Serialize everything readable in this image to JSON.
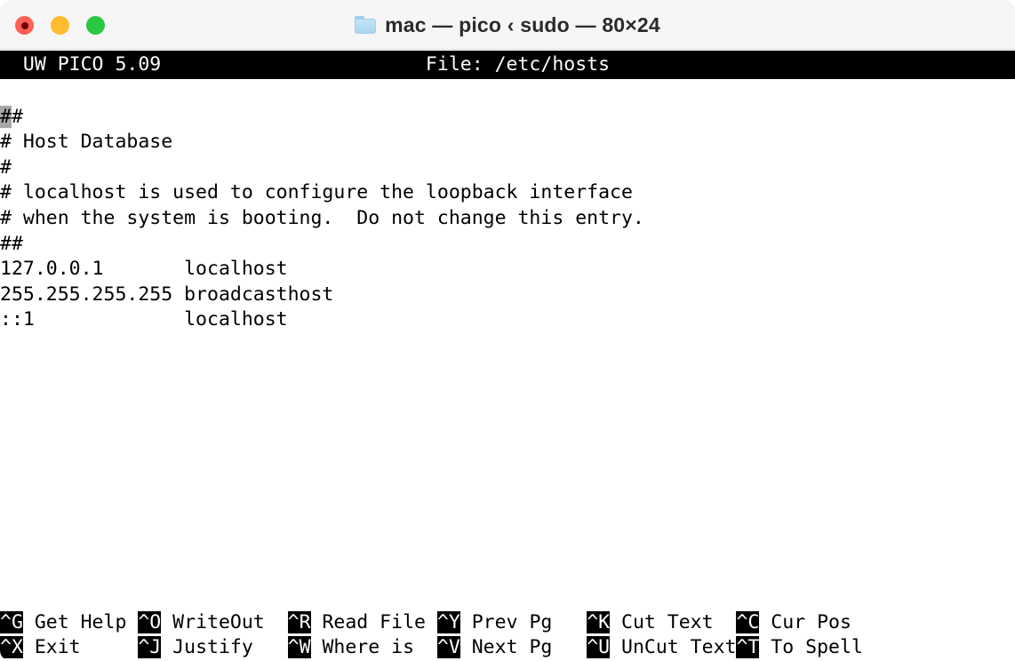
{
  "window": {
    "title": "mac — pico ‹ sudo — 80×24",
    "folder_icon": "folder-icon",
    "traffic_lights": [
      {
        "name": "close",
        "color": "#ff5f57"
      },
      {
        "name": "minimize",
        "color": "#febc2e"
      },
      {
        "name": "zoom",
        "color": "#28c840"
      }
    ]
  },
  "editor": {
    "header": {
      "app_version": "UW PICO 5.09",
      "file_label": "File: /etc/hosts",
      "header_line": "  UW PICO 5.09                       File: /etc/hosts                       ",
      "background": "#000000",
      "foreground": "#ffffff"
    },
    "cursor": {
      "row": 0,
      "col": 0,
      "char": "#",
      "color": "#a8a8a8"
    },
    "content_lines": [
      "##",
      "# Host Database",
      "#",
      "# localhost is used to configure the loopback interface",
      "# when the system is booting.  Do not change this entry.",
      "##",
      "127.0.0.1       localhost",
      "255.255.255.255 broadcasthost",
      "::1             localhost",
      "",
      "",
      "",
      "",
      "",
      "",
      "",
      "",
      "",
      "",
      ""
    ],
    "cursor_line_rest": "#"
  },
  "help_bar": {
    "rows": [
      [
        {
          "key": "^G",
          "label": " Get Help "
        },
        {
          "key": "^O",
          "label": " WriteOut  "
        },
        {
          "key": "^R",
          "label": " Read File "
        },
        {
          "key": "^Y",
          "label": " Prev Pg   "
        },
        {
          "key": "^K",
          "label": " Cut Text  "
        },
        {
          "key": "^C",
          "label": " Cur Pos"
        }
      ],
      [
        {
          "key": "^X",
          "label": " Exit     "
        },
        {
          "key": "^J",
          "label": " Justify   "
        },
        {
          "key": "^W",
          "label": " Where is  "
        },
        {
          "key": "^V",
          "label": " Next Pg   "
        },
        {
          "key": "^U",
          "label": " UnCut Text"
        },
        {
          "key": "^T",
          "label": " To Spell"
        }
      ]
    ]
  },
  "terminal": {
    "columns": 80,
    "rows": 24
  }
}
